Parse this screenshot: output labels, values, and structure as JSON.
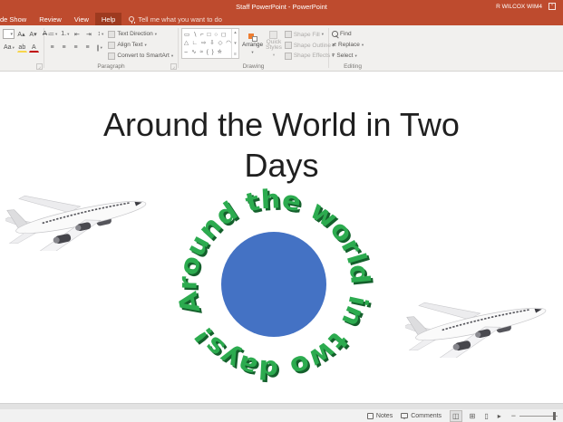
{
  "window": {
    "title": "Staff PowerPoint  -  PowerPoint",
    "user": "R WILCOX WIM4"
  },
  "tabs": {
    "slideshow_partial": "de Show",
    "review": "Review",
    "view": "View",
    "help": "Help",
    "tell_me": "Tell me what you want to do"
  },
  "ribbon": {
    "font": {
      "grow": "A▴",
      "shrink": "A▾",
      "clear": "A",
      "case": "Aa",
      "highlight": "ab",
      "color": "A"
    },
    "paragraph": {
      "label": "Paragraph",
      "bullets": "≔",
      "numbering": "1.",
      "outdent": "⇤",
      "indent": "⇥",
      "spacing": "↕",
      "align_left": "≡",
      "align_center": "≡",
      "align_right": "≡",
      "justify": "≡",
      "columns": "∥",
      "text_direction": "Text Direction",
      "align_text": "Align Text",
      "smartart": "Convert to SmartArt"
    },
    "drawing": {
      "label": "Drawing",
      "gallery_row1": "▭ ∖ ⌐ □ ○ ◻",
      "gallery_row2": "△ ∟ ⇨ ⇩ ◇ ◠",
      "gallery_row3": "⌣ ∿ ≈ { } ☆",
      "arrange": "Arrange",
      "quick_styles": "Quick Styles",
      "shape_fill": "Shape Fill",
      "shape_outline": "Shape Outline",
      "shape_effects": "Shape Effects"
    },
    "editing": {
      "label": "Editing",
      "find": "Find",
      "replace": "Replace",
      "select": "Select"
    }
  },
  "slide": {
    "title_line1": "Around the World in Two",
    "title_line2": "Days",
    "wordart_text": "Around the world in two days!"
  },
  "statusbar": {
    "notes": "Notes",
    "comments": "Comments",
    "zoom_minus": "−"
  },
  "colors": {
    "titlebar": "#BE4B2E",
    "tab_active": "#9E3A1F",
    "wordart_green": "#2CAB4F",
    "wordart_shadow": "#14602C",
    "globe_blue": "#4472C4"
  }
}
